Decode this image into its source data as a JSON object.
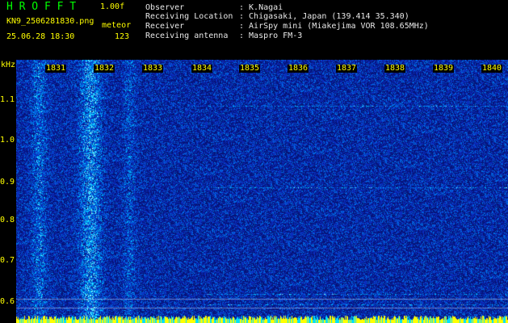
{
  "header": {
    "title": "H R O F F T",
    "version": "1.00f",
    "filename": "KN9_2506281830.png",
    "target": "meteor",
    "datetime": "25.06.28 18:30",
    "count": "123",
    "info": [
      {
        "label": "Observer",
        "value": ": K.Nagai"
      },
      {
        "label": "Receiving Location",
        "value": ": Chigasaki, Japan (139.414 35.340)"
      },
      {
        "label": "Receiver",
        "value": ": AirSpy mini (Miakejima VOR 108.65MHz)"
      },
      {
        "label": "Receiving antenna",
        "value": ": Maspro FM-3"
      }
    ]
  },
  "axis": {
    "unit": "kHz",
    "ticks": [
      "1.1",
      "1.0",
      "0.9",
      "0.8",
      "0.7",
      "0.6"
    ]
  },
  "time_marks": [
    "1831",
    "1832",
    "1833",
    "1834",
    "1835",
    "1836",
    "1837",
    "1838",
    "1839",
    "1840"
  ],
  "colors": {
    "background": "#000000",
    "label_green": "#00ff00",
    "label_yellow": "#ffff00",
    "spectrum_base": "#0a2ab8",
    "spectrum_noise": "#00d8ff",
    "bottom_band": "#ffff00"
  }
}
